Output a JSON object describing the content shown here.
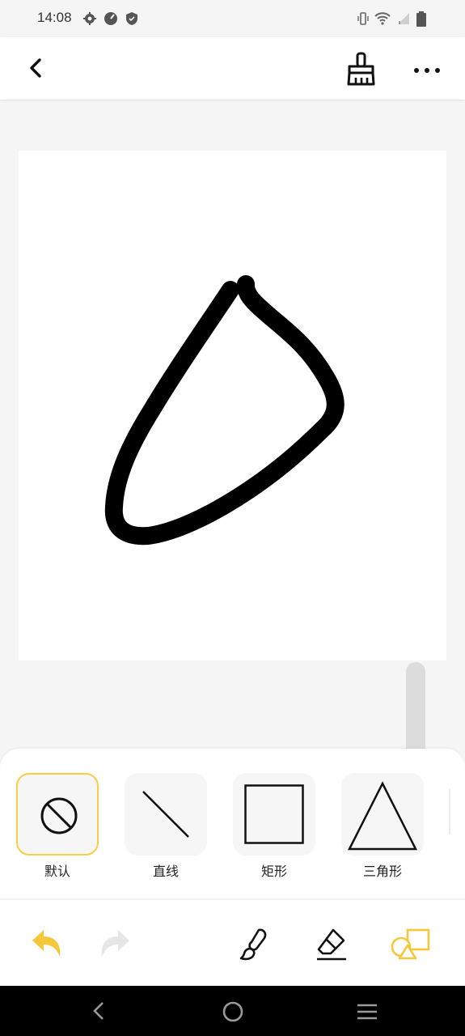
{
  "status_bar": {
    "time": "14:08",
    "icons": [
      "settings-icon",
      "data-saver-icon",
      "shield-icon",
      "vibrate-icon",
      "wifi-icon",
      "signal-icon",
      "battery-icon"
    ]
  },
  "app_bar": {
    "icons": [
      "back-arrow-icon",
      "broom-clear-icon",
      "more-options-icon"
    ]
  },
  "shapes": [
    {
      "id": "default",
      "label": "默认",
      "icon": "no-shape-icon",
      "selected": true
    },
    {
      "id": "line",
      "label": "直线",
      "icon": "line-icon",
      "selected": false
    },
    {
      "id": "rect",
      "label": "矩形",
      "icon": "rectangle-icon",
      "selected": false
    },
    {
      "id": "triangle",
      "label": "三角形",
      "icon": "triangle-icon",
      "selected": false
    }
  ],
  "toolbar": {
    "icons": [
      "undo-icon",
      "redo-icon",
      "brush-icon",
      "eraser-icon",
      "shapes-icon"
    ]
  },
  "colors": {
    "accent": "#f5c73a",
    "disabled": "#e6e6e6",
    "ink": "#000000"
  }
}
